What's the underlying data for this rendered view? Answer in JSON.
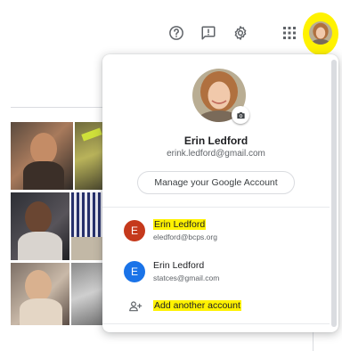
{
  "toolbar": {
    "help_icon": "help-circle-icon",
    "feedback_icon": "feedback-icon",
    "settings_icon": "gear-icon",
    "apps_icon": "apps-grid-icon"
  },
  "highlight_color": "#fff200",
  "profile": {
    "name": "Erin Ledford",
    "email": "erink.ledford@gmail.com",
    "manage_label": "Manage your Google Account"
  },
  "accounts": [
    {
      "initial": "E",
      "name": "Erin Ledford",
      "email": "eledford@bcps.org",
      "color": "#c5391c",
      "highlighted": true
    },
    {
      "initial": "E",
      "name": "Erin Ledford",
      "email": "statces@gmail.com",
      "color": "#1a73e8",
      "highlighted": false
    }
  ],
  "add_account": {
    "label": "Add another account",
    "icon": "person-add-icon"
  }
}
